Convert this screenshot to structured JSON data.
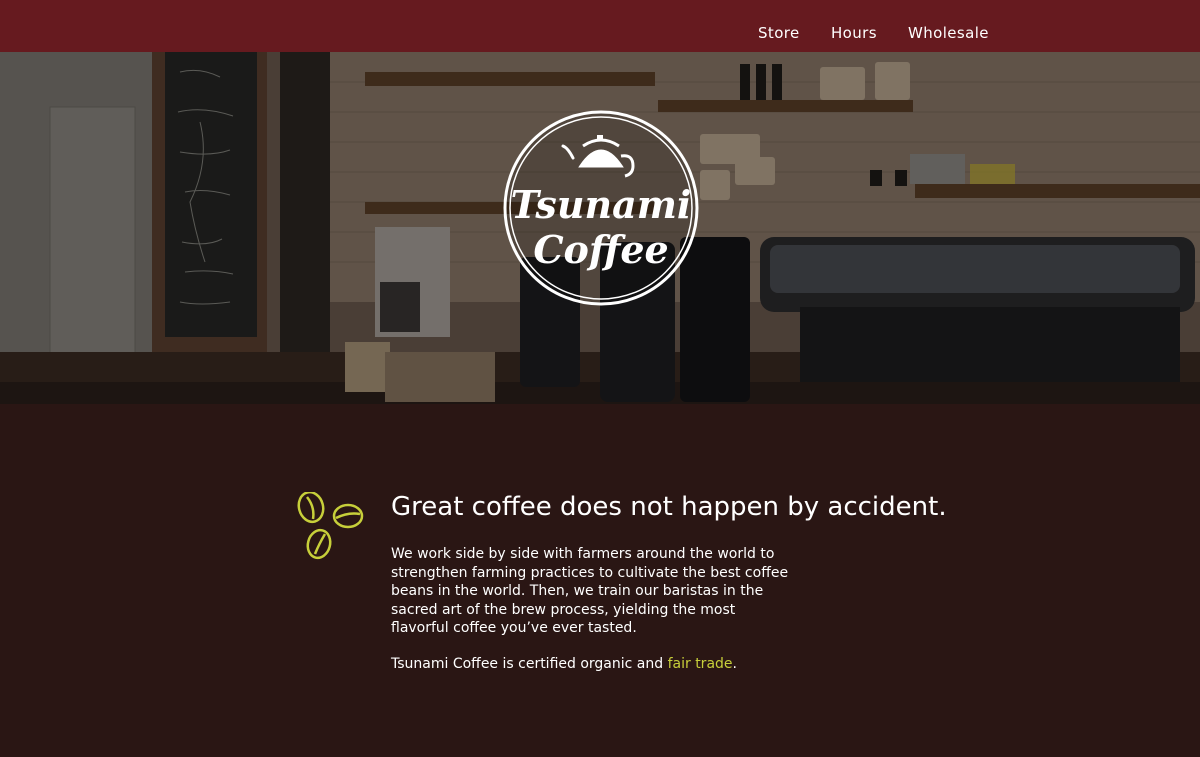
{
  "nav": {
    "items": [
      "Store",
      "Hours",
      "Wholesale"
    ]
  },
  "hero": {
    "logo_line1": "Tsunami",
    "logo_line2": "Coffee",
    "logo_icon": "kettle-icon"
  },
  "content": {
    "icon": "coffee-beans-icon",
    "headline": "Great coffee does not happen by accident.",
    "paragraph": "We work side by side with farmers around the world to strengthen farming practices to cultivate the best coffee beans in the world. Then, we train our baristas in the sacred art of the brew process, yielding the most flavorful coffee you’ve ever tasted.",
    "certified_prefix": "Tsunami Coffee is certified organic and ",
    "certified_link": "fair trade",
    "certified_suffix": "."
  },
  "colors": {
    "nav_bg": "#661a1f",
    "content_bg": "#2a1614",
    "accent": "#c7cf3a"
  }
}
